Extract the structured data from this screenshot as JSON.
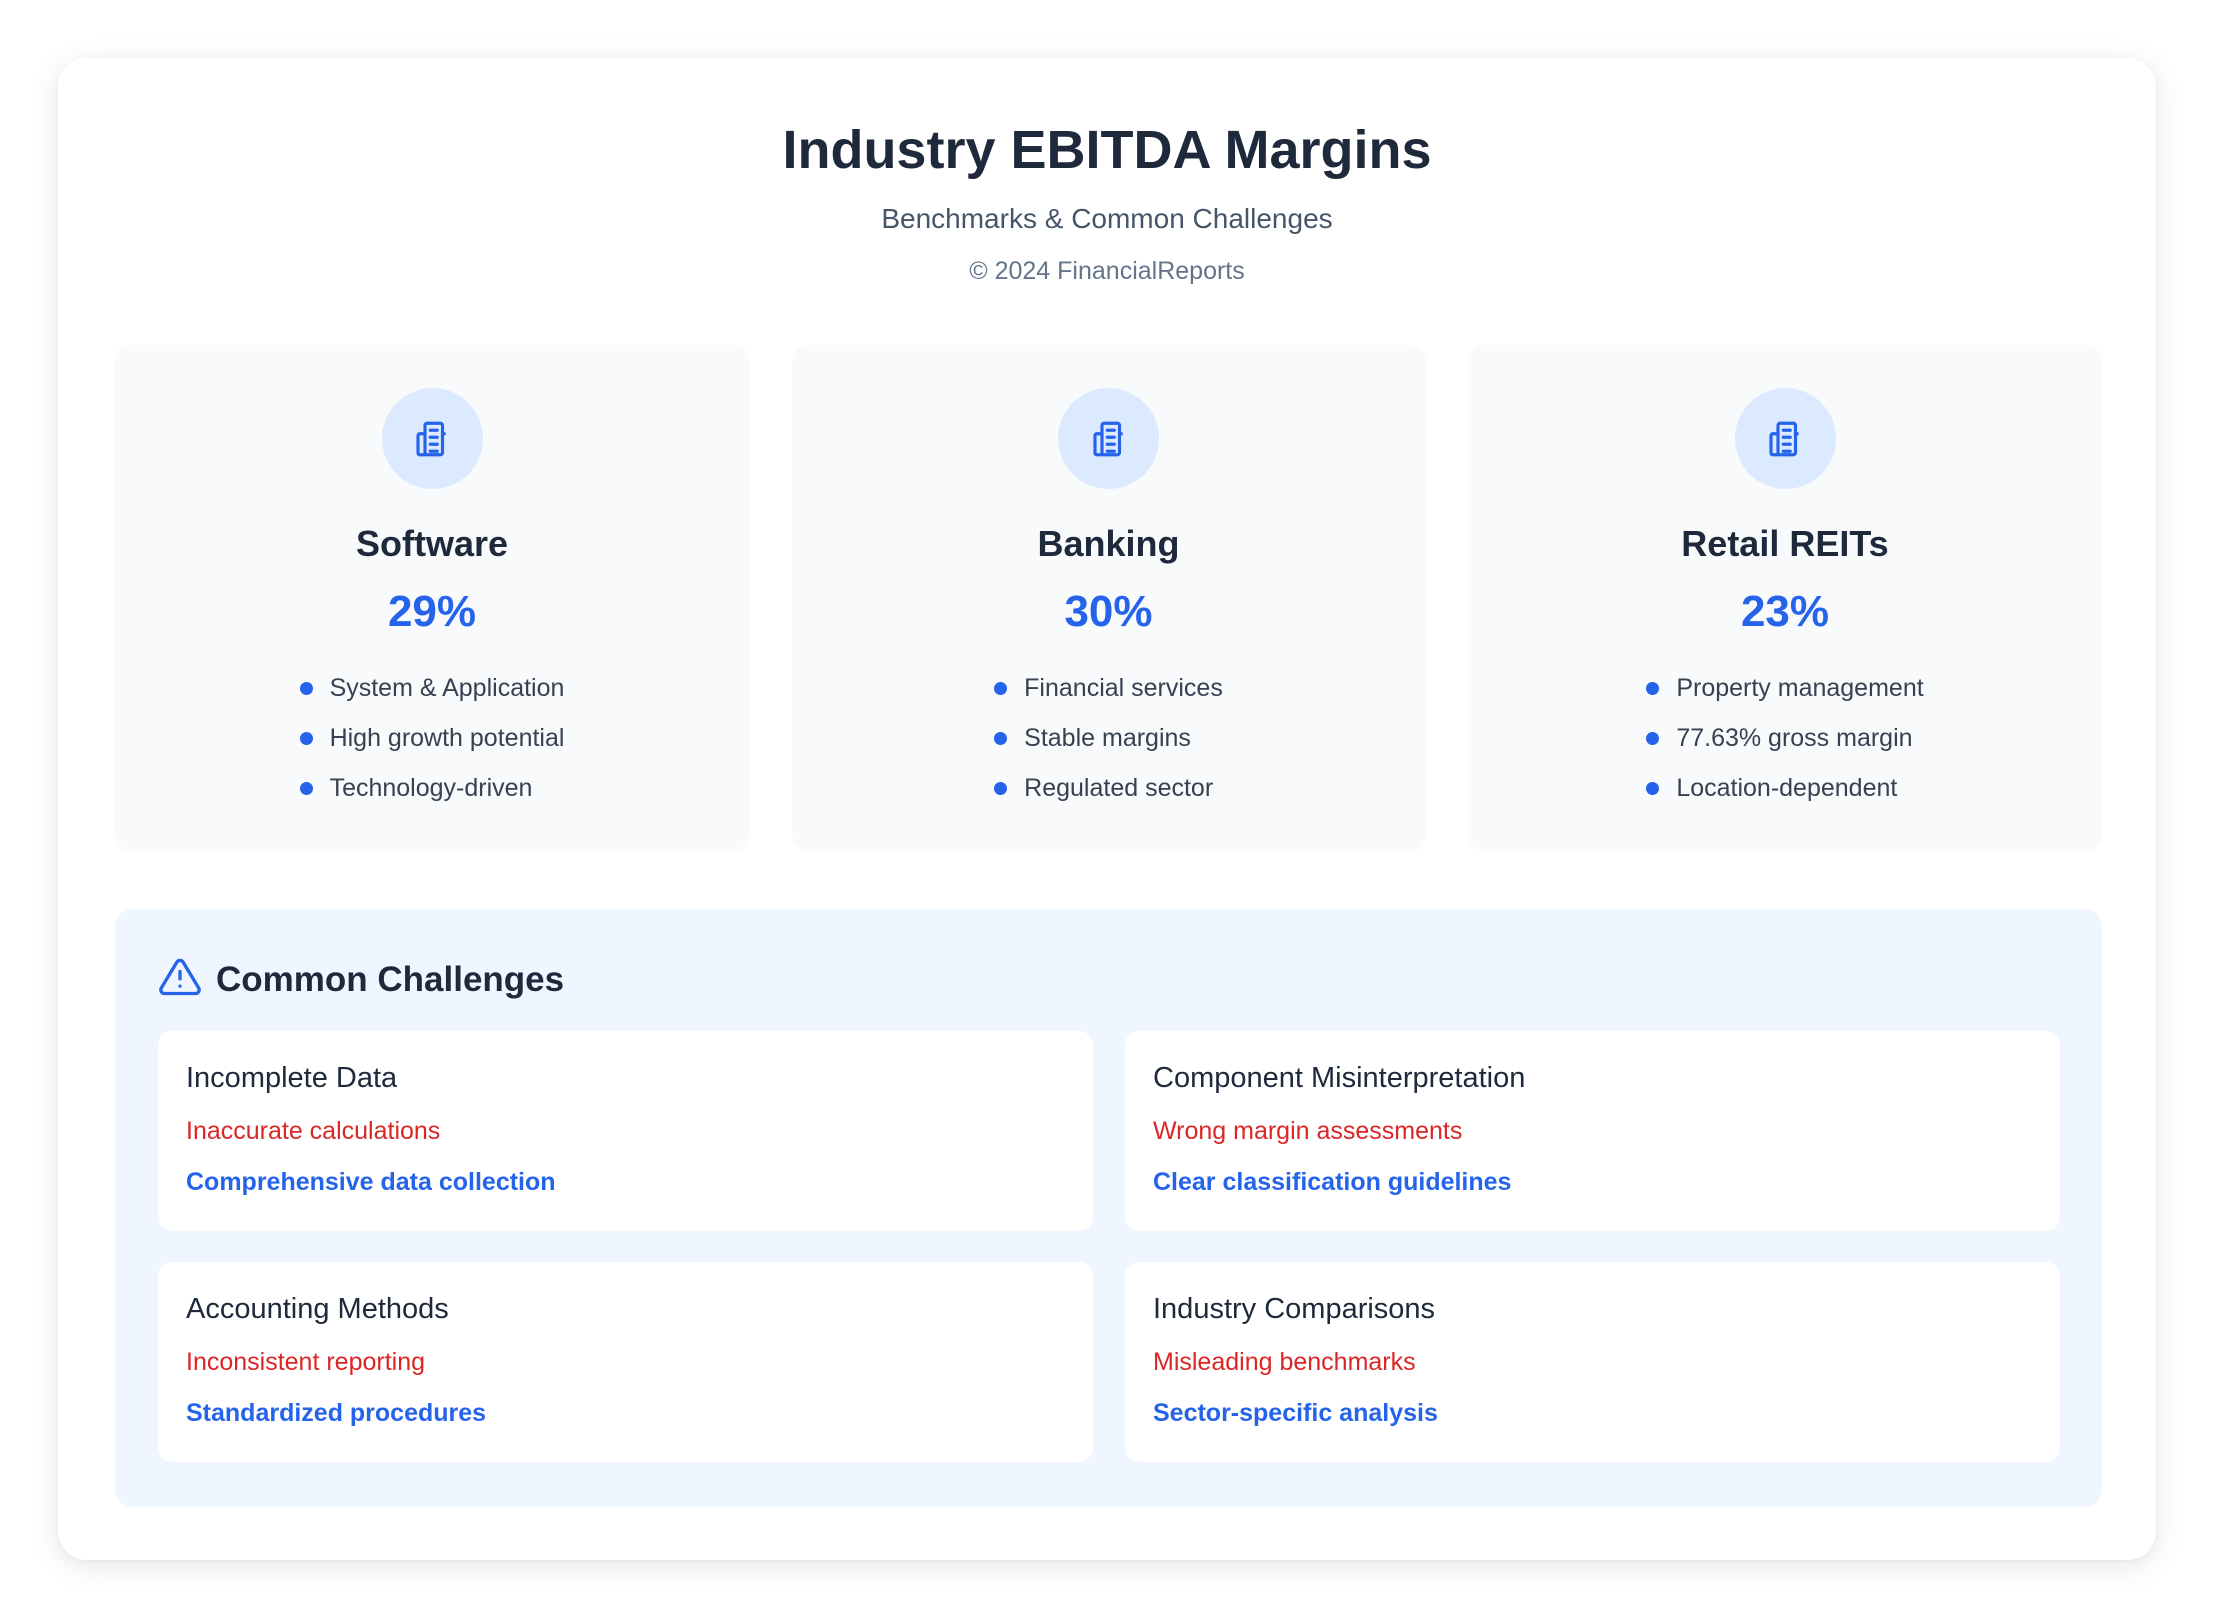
{
  "header": {
    "title": "Industry EBITDA Margins",
    "subtitle": "Benchmarks & Common Challenges",
    "copyright": "© 2024 FinancialReports"
  },
  "industries": [
    {
      "icon": "building-icon",
      "name": "Software",
      "value": "29%",
      "features": [
        "System & Application",
        "High growth potential",
        "Technology-driven"
      ]
    },
    {
      "icon": "building-icon",
      "name": "Banking",
      "value": "30%",
      "features": [
        "Financial services",
        "Stable margins",
        "Regulated sector"
      ]
    },
    {
      "icon": "building-icon",
      "name": "Retail REITs",
      "value": "23%",
      "features": [
        "Property management",
        "77.63% gross margin",
        "Location-dependent"
      ]
    }
  ],
  "challenges": {
    "icon": "warning-triangle-icon",
    "title": "Common Challenges",
    "items": [
      {
        "title": "Incomplete Data",
        "problem": "Inaccurate calculations",
        "solution": "Comprehensive data collection"
      },
      {
        "title": "Component Misinterpretation",
        "problem": "Wrong margin assessments",
        "solution": "Clear classification guidelines"
      },
      {
        "title": "Accounting Methods",
        "problem": "Inconsistent reporting",
        "solution": "Standardized procedures"
      },
      {
        "title": "Industry Comparisons",
        "problem": "Misleading benchmarks",
        "solution": "Sector-specific analysis"
      }
    ]
  },
  "colors": {
    "accent": "#2563eb",
    "problem": "#dc2626",
    "industry_bg": "#f8fafc",
    "challenges_bg": "#eff6ff",
    "icon_bg": "#dbeafe"
  }
}
